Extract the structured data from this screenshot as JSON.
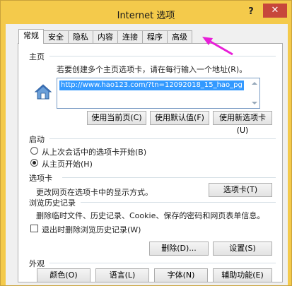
{
  "window": {
    "title": "Internet 选项",
    "help": "?",
    "close": "✕"
  },
  "tabs": [
    "常规",
    "安全",
    "隐私",
    "内容",
    "连接",
    "程序",
    "高级"
  ],
  "home": {
    "heading": "主页",
    "description": "若要创建多个主页选项卡，请在每行输入一个地址(R)。",
    "url": "http://www.hao123.com/?tn=12092018_15_hao_pg",
    "use_current": "使用当前页(C)",
    "use_default": "使用默认值(F)",
    "use_new_tab": "使用新选项卡(U)"
  },
  "startup": {
    "heading": "启动",
    "option_last_session": "从上次会话中的选项卡开始(B)",
    "option_home_page": "从主页开始(H)",
    "selected": "option_home_page"
  },
  "tabs_section": {
    "heading": "选项卡",
    "description": "更改网页在选项卡中的显示方式。",
    "button": "选项卡(T)"
  },
  "history": {
    "heading": "浏览历史记录",
    "description": "删除临时文件、历史记录、Cookie、保存的密码和网页表单信息。",
    "delete_on_exit": "退出时删除浏览历史记录(W)",
    "delete_on_exit_checked": false,
    "delete_button": "删除(D)...",
    "settings_button": "设置(S)"
  },
  "appearance": {
    "heading": "外观",
    "colors": "颜色(O)",
    "languages": "语言(L)",
    "fonts": "字体(N)",
    "accessibility": "辅助功能(E)"
  },
  "colors": {
    "titlebar": "#f4ca4b",
    "close": "#c7473b",
    "selection": "#3399ff",
    "annotation_arrow": "#e81ed8"
  }
}
